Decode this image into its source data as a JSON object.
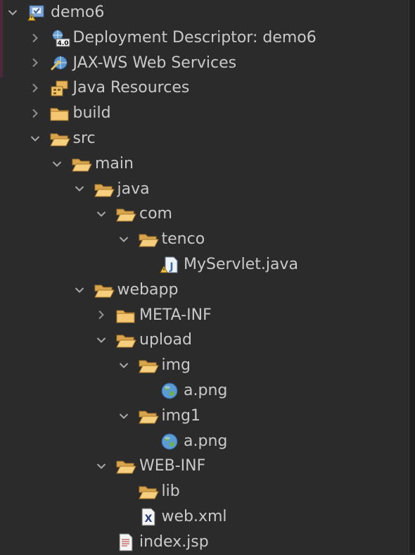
{
  "tree": [
    {
      "label": "demo6",
      "level": 0,
      "twisty": "expanded",
      "icon": "project-icon"
    },
    {
      "label": "Deployment Descriptor: demo6",
      "level": 1,
      "twisty": "collapsed",
      "icon": "deployment-descriptor-icon",
      "badge": "4.0"
    },
    {
      "label": "JAX-WS Web Services",
      "level": 1,
      "twisty": "collapsed",
      "icon": "web-services-icon"
    },
    {
      "label": "Java Resources",
      "level": 1,
      "twisty": "collapsed",
      "icon": "java-resources-icon"
    },
    {
      "label": "build",
      "level": 1,
      "twisty": "collapsed",
      "icon": "folder-icon"
    },
    {
      "label": "src",
      "level": 1,
      "twisty": "expanded",
      "icon": "folder-open-icon"
    },
    {
      "label": "main",
      "level": 2,
      "twisty": "expanded",
      "icon": "folder-open-icon"
    },
    {
      "label": "java",
      "level": 3,
      "twisty": "expanded",
      "icon": "folder-open-icon"
    },
    {
      "label": "com",
      "level": 4,
      "twisty": "expanded",
      "icon": "folder-open-icon"
    },
    {
      "label": "tenco",
      "level": 5,
      "twisty": "expanded",
      "icon": "folder-open-icon"
    },
    {
      "label": "MyServlet.java",
      "level": 6,
      "twisty": "none",
      "icon": "java-file-icon"
    },
    {
      "label": "webapp",
      "level": 3,
      "twisty": "expanded",
      "icon": "folder-open-icon"
    },
    {
      "label": "META-INF",
      "level": 4,
      "twisty": "collapsed",
      "icon": "folder-icon"
    },
    {
      "label": "upload",
      "level": 4,
      "twisty": "expanded",
      "icon": "folder-open-icon"
    },
    {
      "label": "img",
      "level": 5,
      "twisty": "expanded",
      "icon": "folder-open-icon"
    },
    {
      "label": "a.png",
      "level": 6,
      "twisty": "none",
      "icon": "globe-icon"
    },
    {
      "label": "img1",
      "level": 5,
      "twisty": "expanded",
      "icon": "folder-open-icon"
    },
    {
      "label": "a.png",
      "level": 6,
      "twisty": "none",
      "icon": "globe-icon"
    },
    {
      "label": "WEB-INF",
      "level": 4,
      "twisty": "expanded",
      "icon": "folder-open-icon"
    },
    {
      "label": "lib",
      "level": 5,
      "twisty": "none",
      "icon": "folder-open-icon"
    },
    {
      "label": "web.xml",
      "level": 5,
      "twisty": "none",
      "icon": "xml-file-icon"
    },
    {
      "label": "index.jsp",
      "level": 4,
      "twisty": "none",
      "icon": "jsp-file-icon"
    }
  ]
}
